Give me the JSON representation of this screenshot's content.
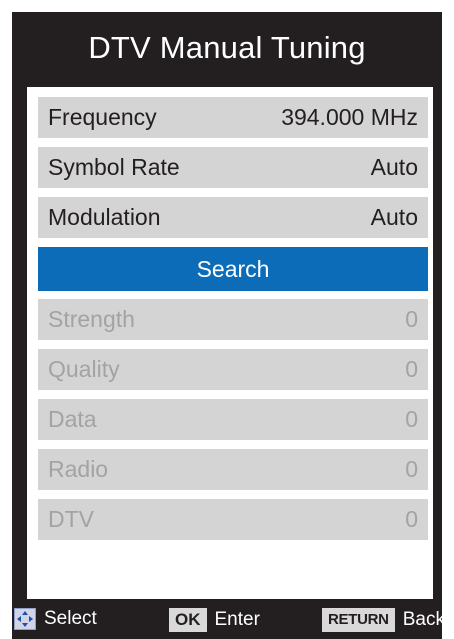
{
  "menu": {
    "title": "DTV Manual Tuning",
    "settings": [
      {
        "label": "Frequency",
        "value": "394.000 MHz"
      },
      {
        "label": "Symbol Rate",
        "value": "Auto"
      },
      {
        "label": "Modulation",
        "value": "Auto"
      }
    ],
    "search_label": "Search",
    "results": [
      {
        "label": "Strength",
        "value": "0"
      },
      {
        "label": "Quality",
        "value": "0"
      },
      {
        "label": "Data",
        "value": "0"
      },
      {
        "label": "Radio",
        "value": "0"
      },
      {
        "label": "DTV",
        "value": "0"
      }
    ]
  },
  "footer": {
    "select_label": "Select",
    "ok_key": "OK",
    "enter_label": "Enter",
    "return_key": "RETURN",
    "back_label": "Back"
  },
  "colors": {
    "background": "#231f20",
    "row": "#d4d4d4",
    "highlight": "#0c6cb8",
    "dim_text": "#a3a3a3"
  }
}
